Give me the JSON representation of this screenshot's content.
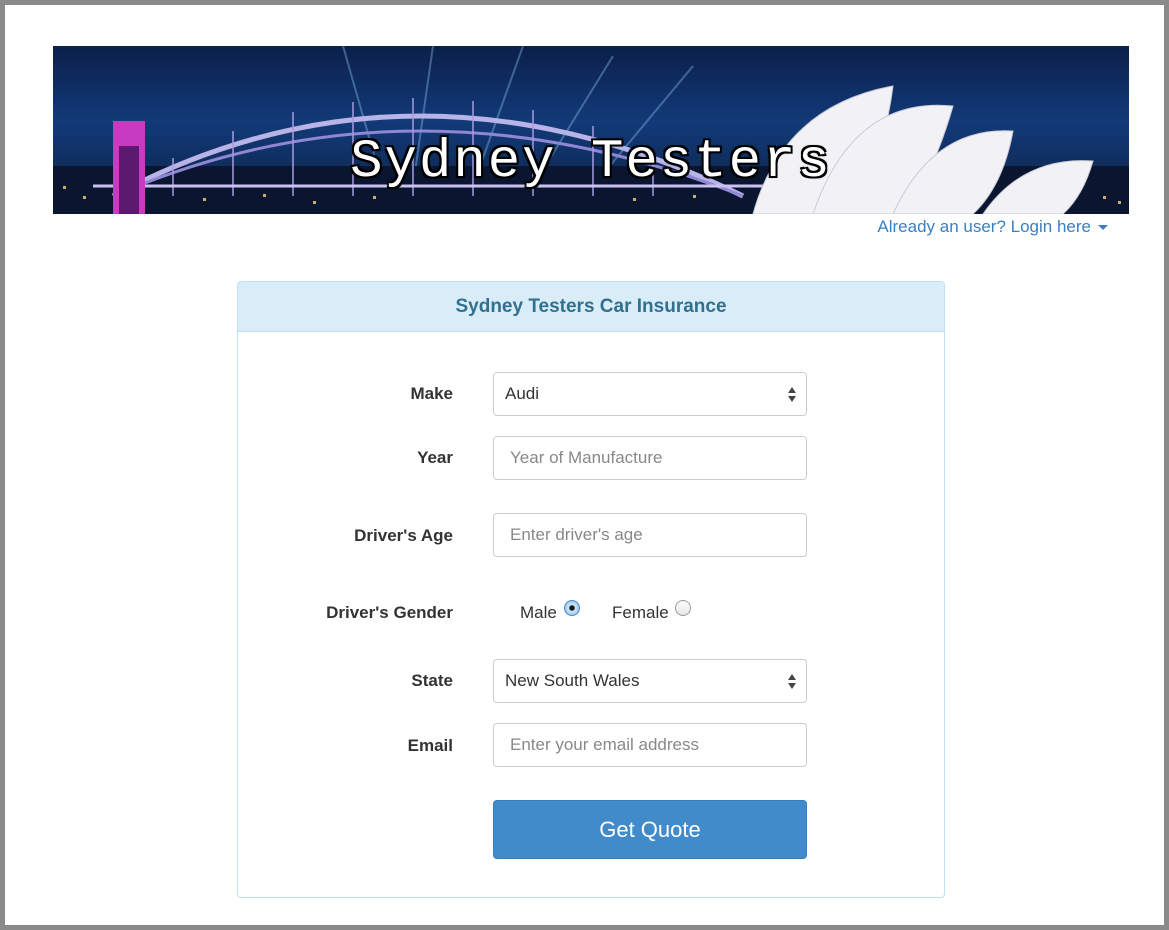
{
  "banner": {
    "title": "Sydney Testers"
  },
  "header": {
    "login_link": "Already an user? Login here"
  },
  "form": {
    "heading": "Sydney Testers Car Insurance",
    "make": {
      "label": "Make",
      "value": "Audi"
    },
    "year": {
      "label": "Year",
      "placeholder": "Year of Manufacture",
      "value": ""
    },
    "age": {
      "label": "Driver's Age",
      "placeholder": "Enter driver's age",
      "value": ""
    },
    "gender": {
      "label": "Driver's Gender",
      "options": [
        {
          "label": "Male",
          "selected": true
        },
        {
          "label": "Female",
          "selected": false
        }
      ]
    },
    "state": {
      "label": "State",
      "value": "New South Wales"
    },
    "email": {
      "label": "Email",
      "placeholder": "Enter your email address",
      "value": ""
    },
    "submit_label": "Get Quote"
  },
  "colors": {
    "link": "#3a7fc4",
    "panel_heading_bg": "#d9edf8",
    "panel_heading_text": "#31708f",
    "primary_button": "#428bca"
  }
}
